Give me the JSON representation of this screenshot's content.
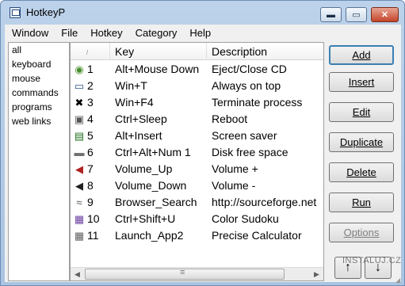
{
  "window": {
    "title": "HotkeyP",
    "min_glyph": "▬",
    "max_glyph": "▭",
    "close_glyph": "✕"
  },
  "menu": [
    "Window",
    "File",
    "Hotkey",
    "Category",
    "Help"
  ],
  "categories": [
    "all",
    "keyboard",
    "mouse",
    "commands",
    "programs",
    "web links"
  ],
  "list": {
    "columns": {
      "sort_glyph": "/",
      "key": "Key",
      "description": "Description"
    },
    "rows": [
      {
        "icon": "cd-icon",
        "glyph": "◉",
        "color": "#4a8f2f",
        "num": "1",
        "key": "Alt+Mouse Down",
        "desc": "Eject/Close CD"
      },
      {
        "icon": "window-icon",
        "glyph": "▭",
        "color": "#2a4f86",
        "num": "2",
        "key": "Win+T",
        "desc": "Always on top"
      },
      {
        "icon": "close-window-icon",
        "glyph": "✖",
        "color": "#000000",
        "num": "3",
        "key": "Win+F4",
        "desc": "Terminate process"
      },
      {
        "icon": "computer-icon",
        "glyph": "▣",
        "color": "#555555",
        "num": "4",
        "key": "Ctrl+Sleep",
        "desc": "Reboot"
      },
      {
        "icon": "monitor-icon",
        "glyph": "▤",
        "color": "#1e6e1e",
        "num": "5",
        "key": "Alt+Insert",
        "desc": "Screen saver"
      },
      {
        "icon": "drive-icon",
        "glyph": "▬",
        "color": "#707070",
        "num": "6",
        "key": "Ctrl+Alt+Num 1",
        "desc": "Disk free space"
      },
      {
        "icon": "speaker-plus-icon",
        "glyph": "◀",
        "color": "#b02020",
        "num": "7",
        "key": "Volume_Up",
        "desc": "Volume +"
      },
      {
        "icon": "speaker-minus-icon",
        "glyph": "◀",
        "color": "#202020",
        "num": "8",
        "key": "Volume_Down",
        "desc": "Volume -"
      },
      {
        "icon": "web-icon",
        "glyph": "≈",
        "color": "#505050",
        "num": "9",
        "key": "Browser_Search",
        "desc": "http://sourceforge.net"
      },
      {
        "icon": "sudoku-icon",
        "glyph": "▦",
        "color": "#6a3fa0",
        "num": "10",
        "key": "Ctrl+Shift+U",
        "desc": "Color Sudoku"
      },
      {
        "icon": "calculator-icon",
        "glyph": "▦",
        "color": "#606060",
        "num": "11",
        "key": "Launch_App2",
        "desc": "Precise Calculator"
      }
    ],
    "scroll_left": "◀",
    "scroll_right": "▶"
  },
  "buttons": {
    "add": "Add",
    "insert": "Insert",
    "edit": "Edit",
    "duplicate": "Duplicate",
    "delete": "Delete",
    "run": "Run",
    "options": "Options",
    "move_up": "↑",
    "move_down": "↓"
  },
  "watermark": "INSTALUJ.CZ"
}
